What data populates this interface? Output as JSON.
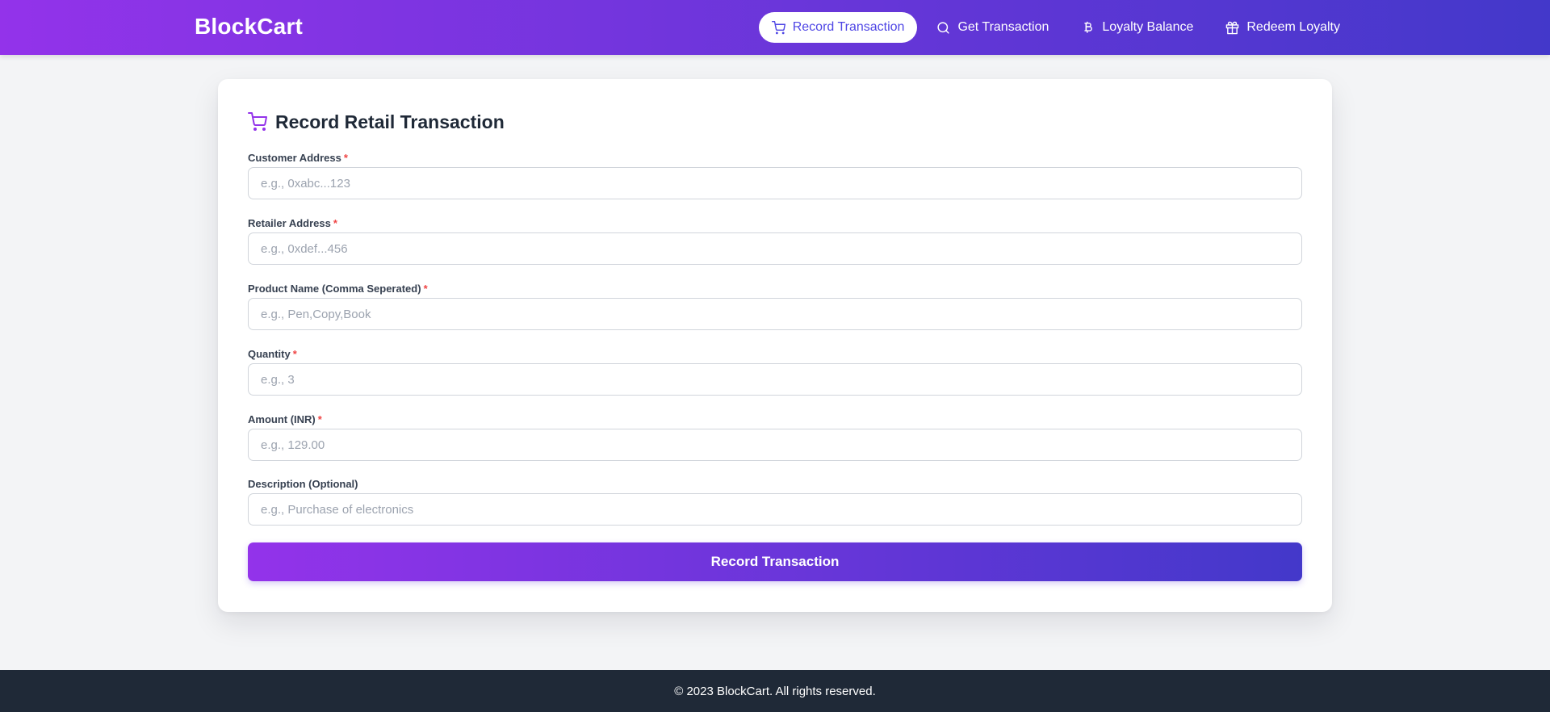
{
  "brand": "BlockCart",
  "nav": [
    {
      "label": "Record Transaction",
      "icon": "cart-icon",
      "active": true
    },
    {
      "label": "Get Transaction",
      "icon": "search-icon",
      "active": false
    },
    {
      "label": "Loyalty Balance",
      "icon": "bitcoin-icon",
      "active": false
    },
    {
      "label": "Redeem Loyalty",
      "icon": "gift-icon",
      "active": false
    }
  ],
  "form": {
    "title": "Record Retail Transaction",
    "title_icon": "cart-icon",
    "required_mark": "*",
    "fields": [
      {
        "label": "Customer Address",
        "placeholder": "e.g., 0xabc...123",
        "value": "",
        "required": true
      },
      {
        "label": "Retailer Address",
        "placeholder": "e.g., 0xdef...456",
        "value": "",
        "required": true
      },
      {
        "label": "Product Name (Comma Seperated)",
        "placeholder": "e.g., Pen,Copy,Book",
        "value": "",
        "required": true
      },
      {
        "label": "Quantity",
        "placeholder": "e.g., 3",
        "value": "",
        "required": true
      },
      {
        "label": "Amount (INR)",
        "placeholder": "e.g., 129.00",
        "value": "",
        "required": true
      },
      {
        "label": "Description (Optional)",
        "placeholder": "e.g., Purchase of electronics",
        "value": "",
        "required": false
      }
    ],
    "submit_label": "Record Transaction"
  },
  "footer": "© 2023 BlockCart. All rights reserved.",
  "colors": {
    "gradient_start": "#9333ea",
    "gradient_end": "#4338ca",
    "active_nav_text": "#4f46e5",
    "required": "#ef4444",
    "footer_bg": "#1f2937",
    "page_bg": "#f3f4f6"
  }
}
